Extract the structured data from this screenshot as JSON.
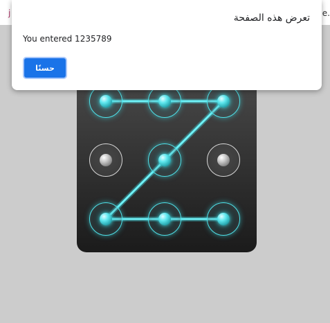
{
  "page": {
    "strip_left_text": "j",
    "strip_right_text": "e."
  },
  "dialog": {
    "title": "تعرض هذه الصفحة",
    "message": "You entered 1235789",
    "ok_label": "حسنًا"
  },
  "pattern": {
    "selected_sequence": "1235789",
    "active_color": "#4fe3ea",
    "inactive_color": "#d8d8d8",
    "nodes": [
      {
        "id": 1,
        "active": true
      },
      {
        "id": 2,
        "active": true
      },
      {
        "id": 3,
        "active": true
      },
      {
        "id": 4,
        "active": false
      },
      {
        "id": 5,
        "active": true
      },
      {
        "id": 6,
        "active": false
      },
      {
        "id": 7,
        "active": true
      },
      {
        "id": 8,
        "active": true
      },
      {
        "id": 9,
        "active": true
      }
    ]
  }
}
